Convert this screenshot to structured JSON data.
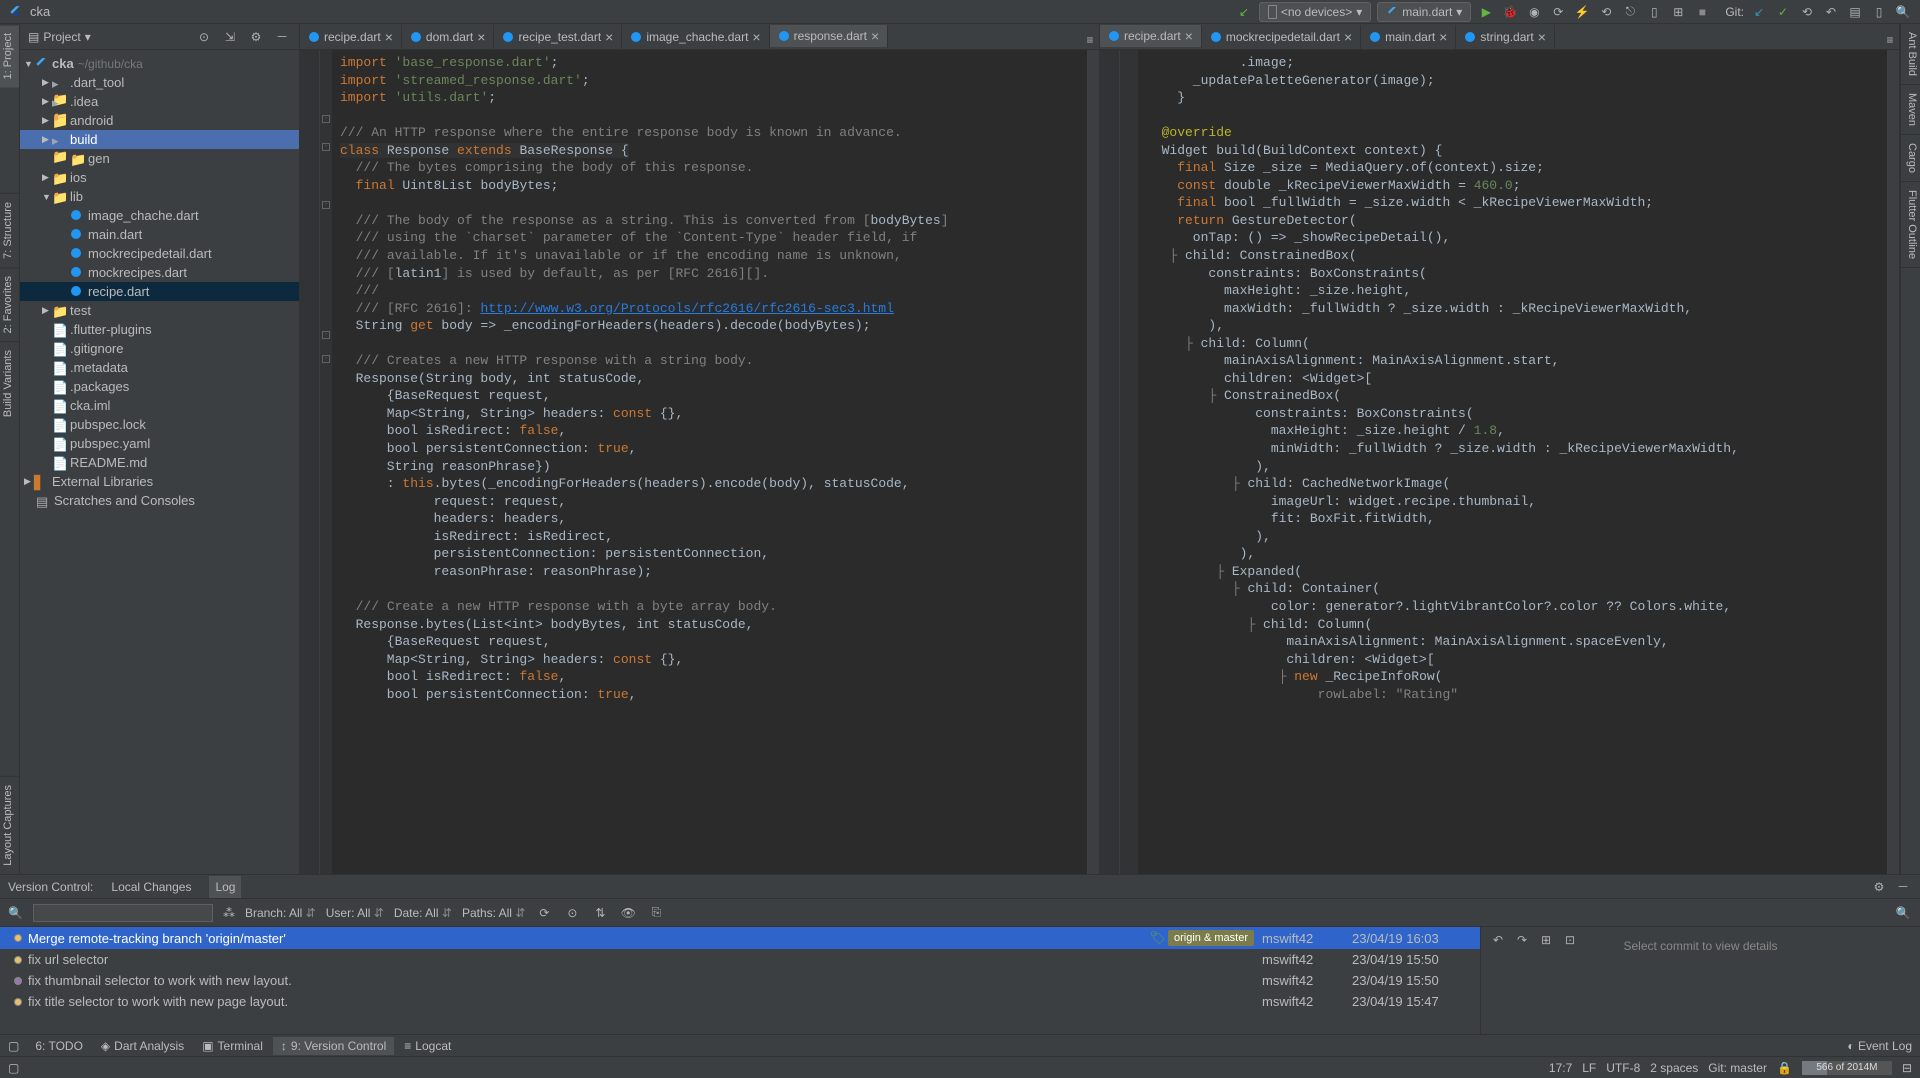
{
  "top": {
    "project": "cka",
    "device": "<no devices>",
    "run_config": "main.dart",
    "git_label": "Git:"
  },
  "sidebar": {
    "title": "Project",
    "root": "cka",
    "root_path": "~/github/cka",
    "items": [
      {
        "label": ".dart_tool",
        "icon": "folder-dot",
        "depth": 1,
        "arrow": "▶"
      },
      {
        "label": ".idea",
        "icon": "folder-dot",
        "depth": 1,
        "arrow": "▶"
      },
      {
        "label": "android",
        "icon": "folder-src",
        "depth": 1,
        "arrow": "▶"
      },
      {
        "label": "build",
        "icon": "folder-dot",
        "depth": 1,
        "arrow": "▶",
        "active": true
      },
      {
        "label": "gen",
        "icon": "folder-gen",
        "depth": 2
      },
      {
        "label": "ios",
        "icon": "folder-src",
        "depth": 1,
        "arrow": "▶"
      },
      {
        "label": "lib",
        "icon": "folder-src",
        "depth": 1,
        "arrow": "▼"
      },
      {
        "label": "image_chache.dart",
        "icon": "dart",
        "depth": 2
      },
      {
        "label": "main.dart",
        "icon": "dart",
        "depth": 2
      },
      {
        "label": "mockrecipedetail.dart",
        "icon": "dart",
        "depth": 2
      },
      {
        "label": "mockrecipes.dart",
        "icon": "dart",
        "depth": 2
      },
      {
        "label": "recipe.dart",
        "icon": "dart",
        "depth": 2,
        "selected": true
      },
      {
        "label": "test",
        "icon": "folder-src",
        "depth": 1,
        "arrow": "▶"
      },
      {
        "label": ".flutter-plugins",
        "icon": "file",
        "depth": 1
      },
      {
        "label": ".gitignore",
        "icon": "file",
        "depth": 1
      },
      {
        "label": ".metadata",
        "icon": "file",
        "depth": 1
      },
      {
        "label": ".packages",
        "icon": "file",
        "depth": 1
      },
      {
        "label": "cka.iml",
        "icon": "file",
        "depth": 1
      },
      {
        "label": "pubspec.lock",
        "icon": "file",
        "depth": 1
      },
      {
        "label": "pubspec.yaml",
        "icon": "file",
        "depth": 1
      },
      {
        "label": "README.md",
        "icon": "file",
        "depth": 1
      }
    ],
    "ext_lib": "External Libraries",
    "scratches": "Scratches and Consoles"
  },
  "left_gutter": [
    "1: Project",
    "7: Structure",
    "2: Favorites",
    "Build Variants",
    "Layout Captures"
  ],
  "right_gutter": [
    "Ant Build",
    "Maven",
    "Cargo",
    "Flutter Outline"
  ],
  "editor_left": {
    "tabs": [
      "recipe.dart",
      "dom.dart",
      "recipe_test.dart",
      "image_chache.dart",
      "response.dart"
    ],
    "active_tab": 4
  },
  "editor_right": {
    "tabs": [
      "recipe.dart",
      "mockrecipedetail.dart",
      "main.dart",
      "string.dart"
    ],
    "active_tab": 0
  },
  "vcs": {
    "header": "Version Control:",
    "subtabs": [
      "Local Changes",
      "Log"
    ],
    "active": 1,
    "filters": {
      "branch": "Branch: All",
      "user": "User: All",
      "date": "Date: All",
      "paths": "Paths: All"
    },
    "commits": [
      {
        "msg": "Merge remote-tracking branch 'origin/master'",
        "author": "mswift42",
        "date": "23/04/19 16:03",
        "tags": [
          "origin & master"
        ],
        "active": true,
        "dot": "yellow"
      },
      {
        "msg": "fix url selector",
        "author": "mswift42",
        "date": "23/04/19 15:50",
        "dot": "yellow"
      },
      {
        "msg": "fix thumbnail selector to work with new layout.",
        "author": "mswift42",
        "date": "23/04/19 15:50",
        "dot": "purple"
      },
      {
        "msg": "fix title selector to work with new page layout.",
        "author": "mswift42",
        "date": "23/04/19 15:47",
        "dot": "yellow"
      }
    ],
    "detail_placeholder": "Select commit to view details"
  },
  "bottom_tools": [
    "6: TODO",
    "Dart Analysis",
    "Terminal",
    "9: Version Control",
    "Logcat"
  ],
  "bottom_active": 3,
  "event_log": "Event Log",
  "status": {
    "pos": "17:7",
    "lf": "LF",
    "enc": "UTF-8",
    "indent": "2 spaces",
    "git": "Git: master",
    "mem": "566 of 2014M"
  }
}
